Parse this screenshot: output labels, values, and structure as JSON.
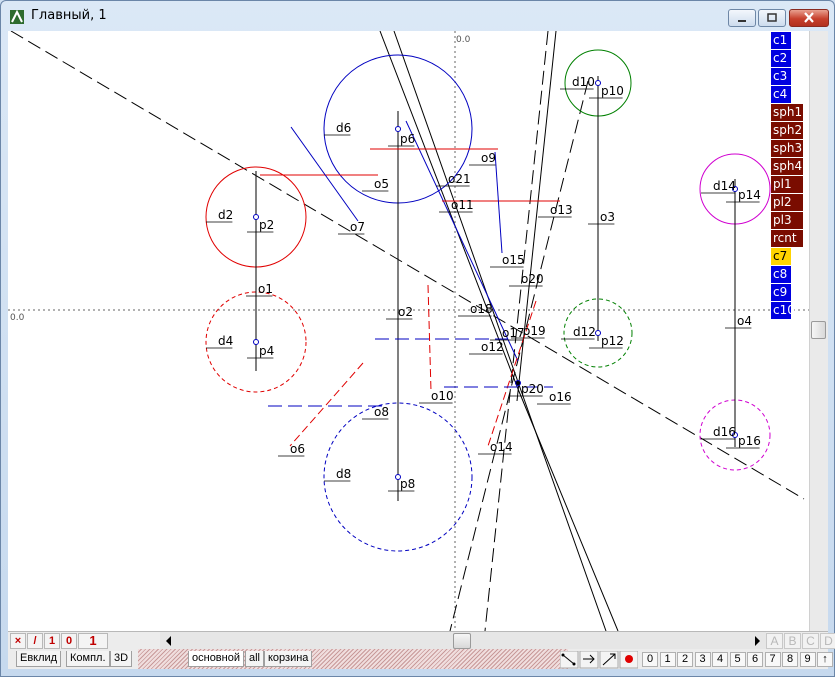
{
  "window": {
    "title": "Главный, 1"
  },
  "canvas": {
    "axis_x_label": "0.0",
    "axis_y_label": "0.0",
    "labels": [
      "d6",
      "p6",
      "o5",
      "o9",
      "o21",
      "o11",
      "o13",
      "d10",
      "p10",
      "d2",
      "p2",
      "o7",
      "o3",
      "d14",
      "p14",
      "o15",
      "o20",
      "o1",
      "o2",
      "o18",
      "o4",
      "d4",
      "p4",
      "o17",
      "o19",
      "d12",
      "p12",
      "o12",
      "p20",
      "o16",
      "o10",
      "o8",
      "d16",
      "p16",
      "o14",
      "o6",
      "d8",
      "p8"
    ]
  },
  "layers": [
    {
      "label": "c1",
      "kind": "blue"
    },
    {
      "label": "c2",
      "kind": "blue"
    },
    {
      "label": "c3",
      "kind": "blue"
    },
    {
      "label": "c4",
      "kind": "blue"
    },
    {
      "label": "sph1",
      "kind": "maroon"
    },
    {
      "label": "sph2",
      "kind": "maroon"
    },
    {
      "label": "sph3",
      "kind": "maroon"
    },
    {
      "label": "sph4",
      "kind": "maroon"
    },
    {
      "label": "pl1",
      "kind": "maroon"
    },
    {
      "label": "pl2",
      "kind": "maroon"
    },
    {
      "label": "pl3",
      "kind": "maroon"
    },
    {
      "label": "rcnt",
      "kind": "maroon"
    },
    {
      "label": "c7",
      "kind": "yellow"
    },
    {
      "label": "c8",
      "kind": "blue"
    },
    {
      "label": "c9",
      "kind": "blue"
    },
    {
      "label": "c10",
      "kind": "blue"
    }
  ],
  "statusbar": {
    "close_glyph": "×",
    "line_glyph": "/",
    "one_small": "1",
    "zero_small": "0",
    "one_big": "1",
    "abcd": [
      "A",
      "B",
      "C",
      "D"
    ]
  },
  "tabs": {
    "left": [
      "Евклид",
      "Компл.",
      "3D"
    ],
    "sheets": [
      "основной",
      "all",
      "корзина"
    ]
  },
  "numbers": [
    "0",
    "1",
    "2",
    "3",
    "4",
    "5",
    "6",
    "7",
    "8",
    "9",
    "↑"
  ],
  "colors": {
    "blue": "#0000e0",
    "maroon": "#7a0c00",
    "yellow": "#ffd400",
    "red": "#e00000",
    "green": "#008000",
    "magenta": "#d000d0"
  }
}
